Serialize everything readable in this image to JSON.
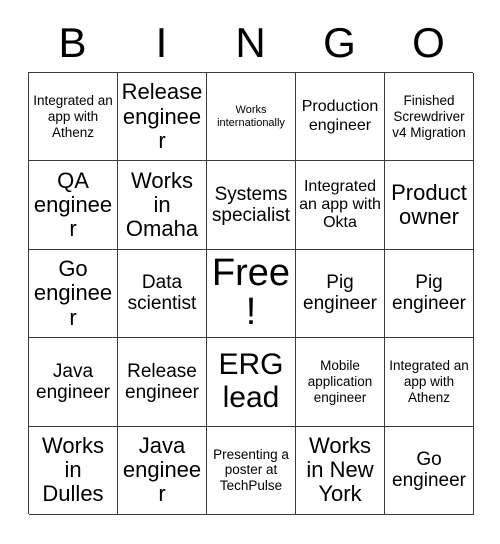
{
  "card": {
    "header_letters": [
      "B",
      "I",
      "N",
      "G",
      "O"
    ],
    "rows": [
      [
        {
          "text": "Integrated an app with Athenz",
          "size": "s"
        },
        {
          "text": "Release engineer",
          "size": "xl"
        },
        {
          "text": "Works internationally",
          "size": "xs"
        },
        {
          "text": "Production engineer",
          "size": "m"
        },
        {
          "text": "Finished Screwdriver v4 Migration",
          "size": "s"
        }
      ],
      [
        {
          "text": "QA engineer",
          "size": "xl"
        },
        {
          "text": "Works in Omaha",
          "size": "xl"
        },
        {
          "text": "Systems specialist",
          "size": "l"
        },
        {
          "text": "Integrated an app with Okta",
          "size": "m"
        },
        {
          "text": "Product owner",
          "size": "xl"
        }
      ],
      [
        {
          "text": "Go engineer",
          "size": "xl"
        },
        {
          "text": "Data scientist",
          "size": "l"
        },
        {
          "text": "Free!",
          "size": "free"
        },
        {
          "text": "Pig engineer",
          "size": "l"
        },
        {
          "text": "Pig engineer",
          "size": "l"
        }
      ],
      [
        {
          "text": "Java engineer",
          "size": "l"
        },
        {
          "text": "Release engineer",
          "size": "l"
        },
        {
          "text": "ERG lead",
          "size": "xxl"
        },
        {
          "text": "Mobile application engineer",
          "size": "s"
        },
        {
          "text": "Integrated an app with Athenz",
          "size": "s"
        }
      ],
      [
        {
          "text": "Works in Dulles",
          "size": "xl"
        },
        {
          "text": "Java engineer",
          "size": "xl"
        },
        {
          "text": "Presenting a poster at TechPulse",
          "size": "s"
        },
        {
          "text": "Works in New York",
          "size": "xl"
        },
        {
          "text": "Go engineer",
          "size": "l"
        }
      ]
    ]
  },
  "colors": {
    "background": "#ffffff",
    "text": "#000000",
    "grid_line": "#3a3a3a"
  }
}
